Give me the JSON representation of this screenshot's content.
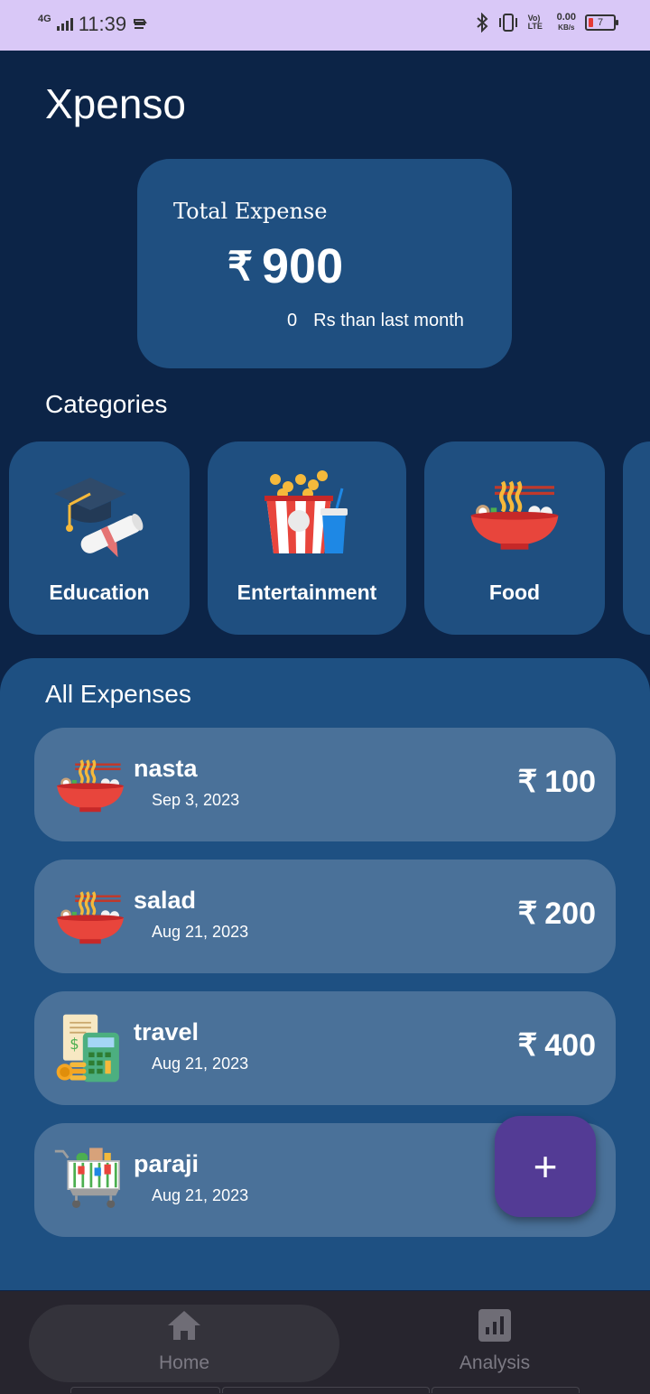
{
  "status_bar": {
    "network": "4G",
    "time": "11:39",
    "volte": "Vo) LTE",
    "speed": "0.00",
    "speed_unit": "KB/s",
    "battery": "7"
  },
  "app": {
    "title": "Xpenso"
  },
  "total": {
    "label": "Total Expense",
    "currency": "₹",
    "amount": "900",
    "diff": "0",
    "diff_text": "Rs than last month"
  },
  "categories": {
    "title": "Categories",
    "items": [
      {
        "label": "Education",
        "icon": "graduation-icon"
      },
      {
        "label": "Entertainment",
        "icon": "popcorn-icon"
      },
      {
        "label": "Food",
        "icon": "noodle-bowl-icon"
      }
    ]
  },
  "expenses": {
    "title": "All Expenses",
    "items": [
      {
        "name": "nasta",
        "date": "Sep 3, 2023",
        "amount": "100",
        "icon": "noodle-bowl-icon"
      },
      {
        "name": "salad",
        "date": "Aug 21, 2023",
        "amount": "200",
        "icon": "noodle-bowl-icon"
      },
      {
        "name": "travel",
        "date": "Aug 21, 2023",
        "amount": "400",
        "icon": "calculator-bill-icon"
      },
      {
        "name": "paraji",
        "date": "Aug 21, 2023",
        "amount": "",
        "icon": "shopping-cart-icon"
      }
    ]
  },
  "fab": {
    "label": "+"
  },
  "nav": {
    "home": "Home",
    "analysis": "Analysis"
  },
  "colors": {
    "background": "#0c2447",
    "card": "#1f4f80",
    "expense_card": "#4a7199",
    "fab": "#533b95",
    "status_bar": "#d9c8f7"
  }
}
